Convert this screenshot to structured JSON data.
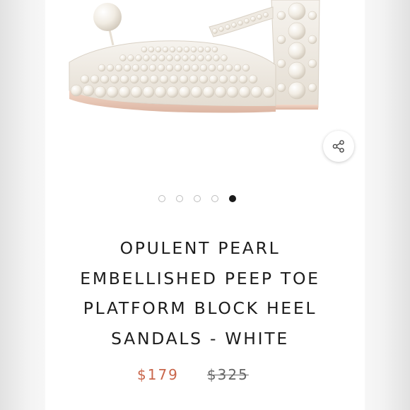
{
  "product": {
    "title_lines": [
      "OPULENT PEARL",
      "EMBELLISHED PEEP TOE",
      "PLATFORM BLOCK HEEL",
      "SANDALS - WHITE"
    ],
    "price_sale": "$179",
    "price_original": "$325",
    "image": {
      "subject": "white pearl embellished platform block heel sandal"
    }
  },
  "carousel": {
    "slide_count": 5,
    "active_index": 4
  },
  "icons": {
    "share": "share-icon"
  },
  "colors": {
    "sale_price": "#c9664b",
    "original_price": "#666666",
    "title_text": "#1c1c1c",
    "active_dot": "#1a1a1a",
    "inactive_dot_border": "#bdbdbd",
    "pearl": "#f3efe6",
    "sole": "#e8c9b8"
  }
}
